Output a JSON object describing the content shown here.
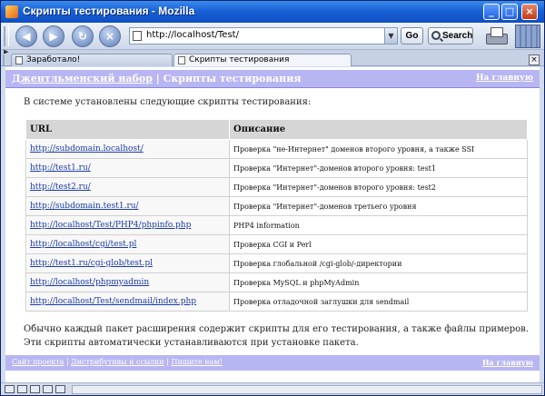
{
  "window": {
    "title": "Скрипты тестирования - Mozilla"
  },
  "toolbar": {
    "url": "http://localhost/Test/",
    "go_label": "Go",
    "search_label": "Search"
  },
  "tabs": [
    {
      "label": "Заработало!"
    },
    {
      "label": "Скрипты тестирования"
    }
  ],
  "page": {
    "header": {
      "breadcrumb_link": "Джентльменский набор",
      "breadcrumb_sep": " | ",
      "breadcrumb_current": "Скрипты тестирования",
      "home_link": "На главную"
    },
    "intro": "В системе установлены следующие скрипты тестирования:",
    "table": {
      "columns": [
        "URL",
        "Описание"
      ],
      "rows": [
        {
          "url": "http://subdomain.localhost/",
          "desc": "Проверка \"не-Интернет\" доменов второго уровня, а также SSI"
        },
        {
          "url": "http://test1.ru/",
          "desc": "Проверка \"Интернет\"-доменов второго уровня: test1"
        },
        {
          "url": "http://test2.ru/",
          "desc": "Проверка \"Интернет\"-доменов второго уровня: test2"
        },
        {
          "url": "http://subdomain.test1.ru/",
          "desc": "Проверка \"Интернет\"-доменов третьего уровня"
        },
        {
          "url": "http://localhost/Test/PHP4/phpinfo.php",
          "desc": "PHP4 information"
        },
        {
          "url": "http://localhost/cgi/test.pl",
          "desc": "Проверка CGI и Perl"
        },
        {
          "url": "http://test1.ru/cgi-glob/test.pl",
          "desc": "Проверка глобальной /cgi-glob/-директории"
        },
        {
          "url": "http://localhost/phpmyadmin",
          "desc": "Проверка MySQL и phpMyAdmin"
        },
        {
          "url": "http://localhost/Test/sendmail/index.php",
          "desc": "Проверка отладочной заглушки для sendmail"
        }
      ]
    },
    "outro": "Обычно каждый пакет расширения содержит скрипты для его тестирования, а также файлы примеров. Эти скрипты автоматически устанавливаются при установке пакета.",
    "footer": {
      "link1": "Сайт проекта",
      "link2": "Дистрибутивы и ссылки",
      "link3": "Пишите нам!",
      "sep": " | ",
      "home_link": "На главную"
    }
  },
  "colors": {
    "header_bg": "#b8b6f2",
    "link": "#1a3ba8",
    "titlebar": "#1862d6"
  }
}
